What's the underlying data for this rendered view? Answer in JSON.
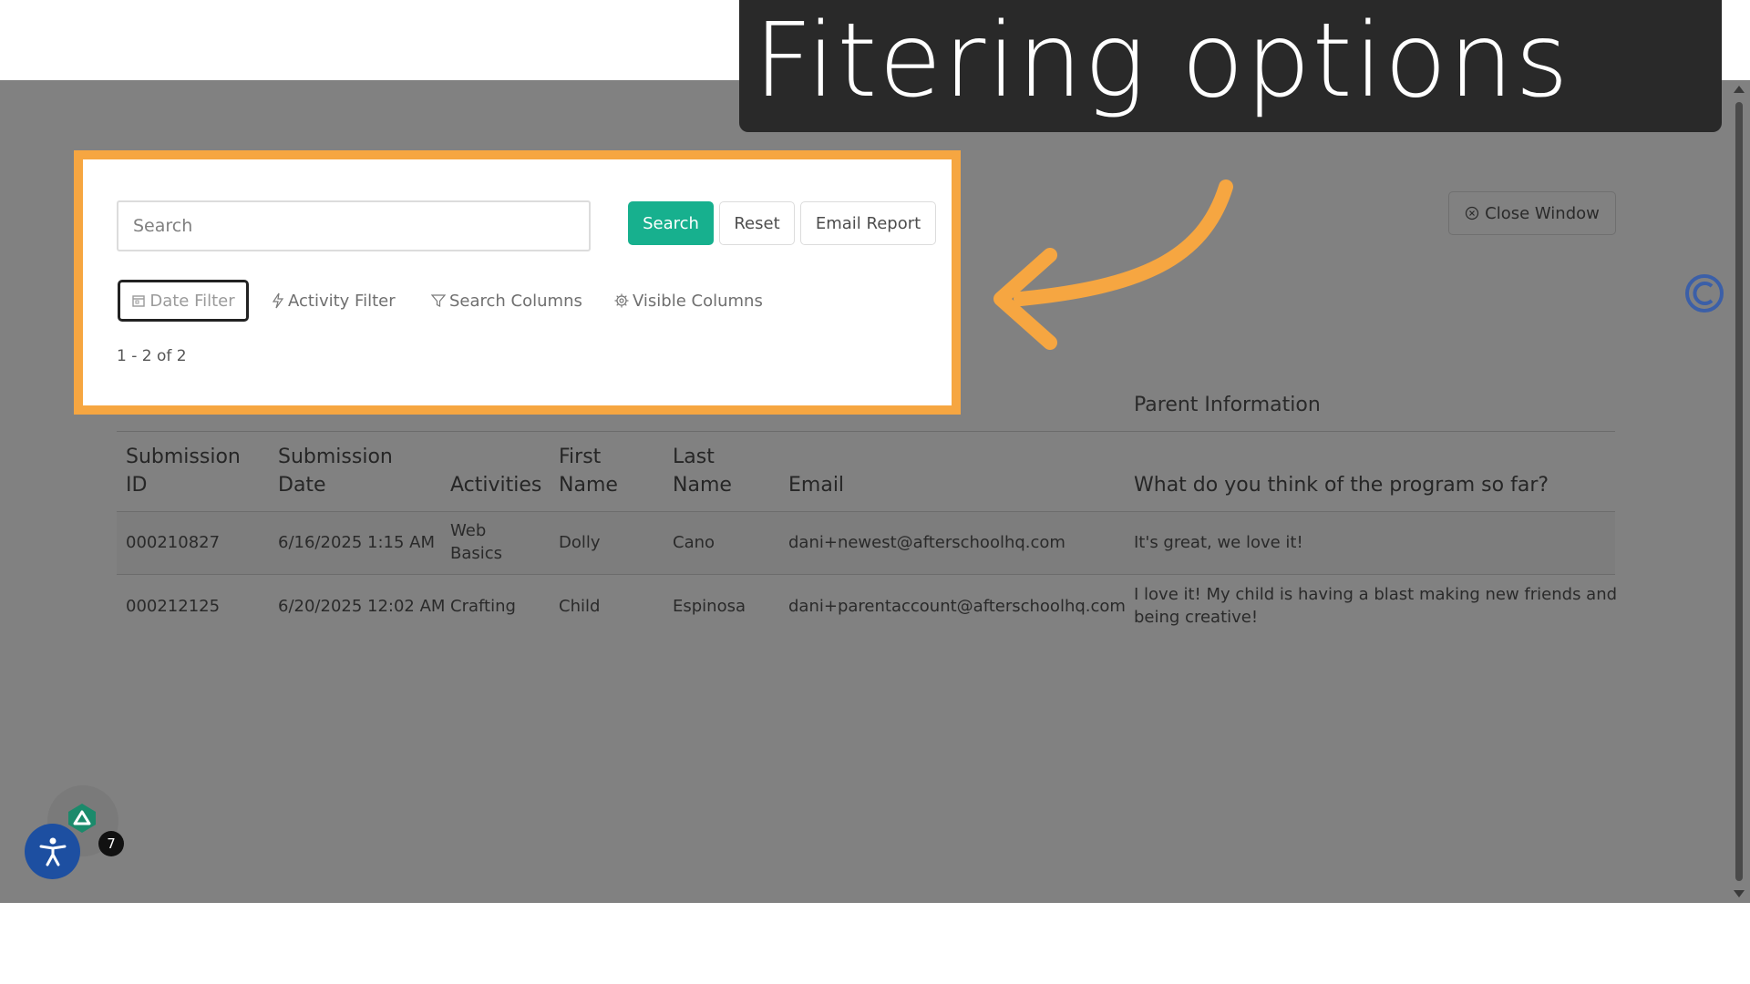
{
  "banner": {
    "title": "Fitering options"
  },
  "panel": {
    "search_placeholder": "Search",
    "buttons": {
      "search": "Search",
      "reset": "Reset",
      "email_report": "Email Report"
    },
    "filters": {
      "date": "Date Filter",
      "activity": "Activity Filter",
      "search_columns": "Search Columns",
      "visible_columns": "Visible Columns"
    },
    "result_count": "1 - 2 of 2"
  },
  "close_window": "Close Window",
  "table": {
    "group_header": "Parent Information",
    "headers": {
      "submission_id": [
        "Submission",
        "ID"
      ],
      "submission_date": [
        "Submission",
        "Date"
      ],
      "activities": "Activities",
      "first_name": [
        "First",
        "Name"
      ],
      "last_name": [
        "Last",
        "Name"
      ],
      "email": "Email",
      "question": "What do you think of the program so far?"
    },
    "rows": [
      {
        "submission_id": "000210827",
        "submission_date": "6/16/2025 1:15 AM",
        "activities": [
          "Web",
          "Basics"
        ],
        "first_name": "Dolly",
        "last_name": "Cano",
        "email": "dani+newest@afterschoolhq.com",
        "answer": [
          "It's great, we love it!"
        ]
      },
      {
        "submission_id": "000212125",
        "submission_date": "6/20/2025 12:02 AM",
        "activities": [
          "Crafting"
        ],
        "first_name": "Child",
        "last_name": "Espinosa",
        "email": "dani+parentaccount@afterschoolhq.com",
        "answer": [
          "I love it! My child is having a blast making new friends and",
          "being creative!"
        ]
      }
    ]
  },
  "widgets": {
    "badge_count": "7"
  },
  "colors": {
    "highlight": "#f6a641",
    "primary_button": "#17b08e",
    "overlay": "#818181",
    "banner": "#292929",
    "accessibility": "#1d4fa1"
  },
  "icons": [
    "calendar-icon",
    "bolt-icon",
    "filter-icon",
    "gear-icon",
    "close-circle-icon",
    "accessibility-icon",
    "arrow-icon"
  ]
}
